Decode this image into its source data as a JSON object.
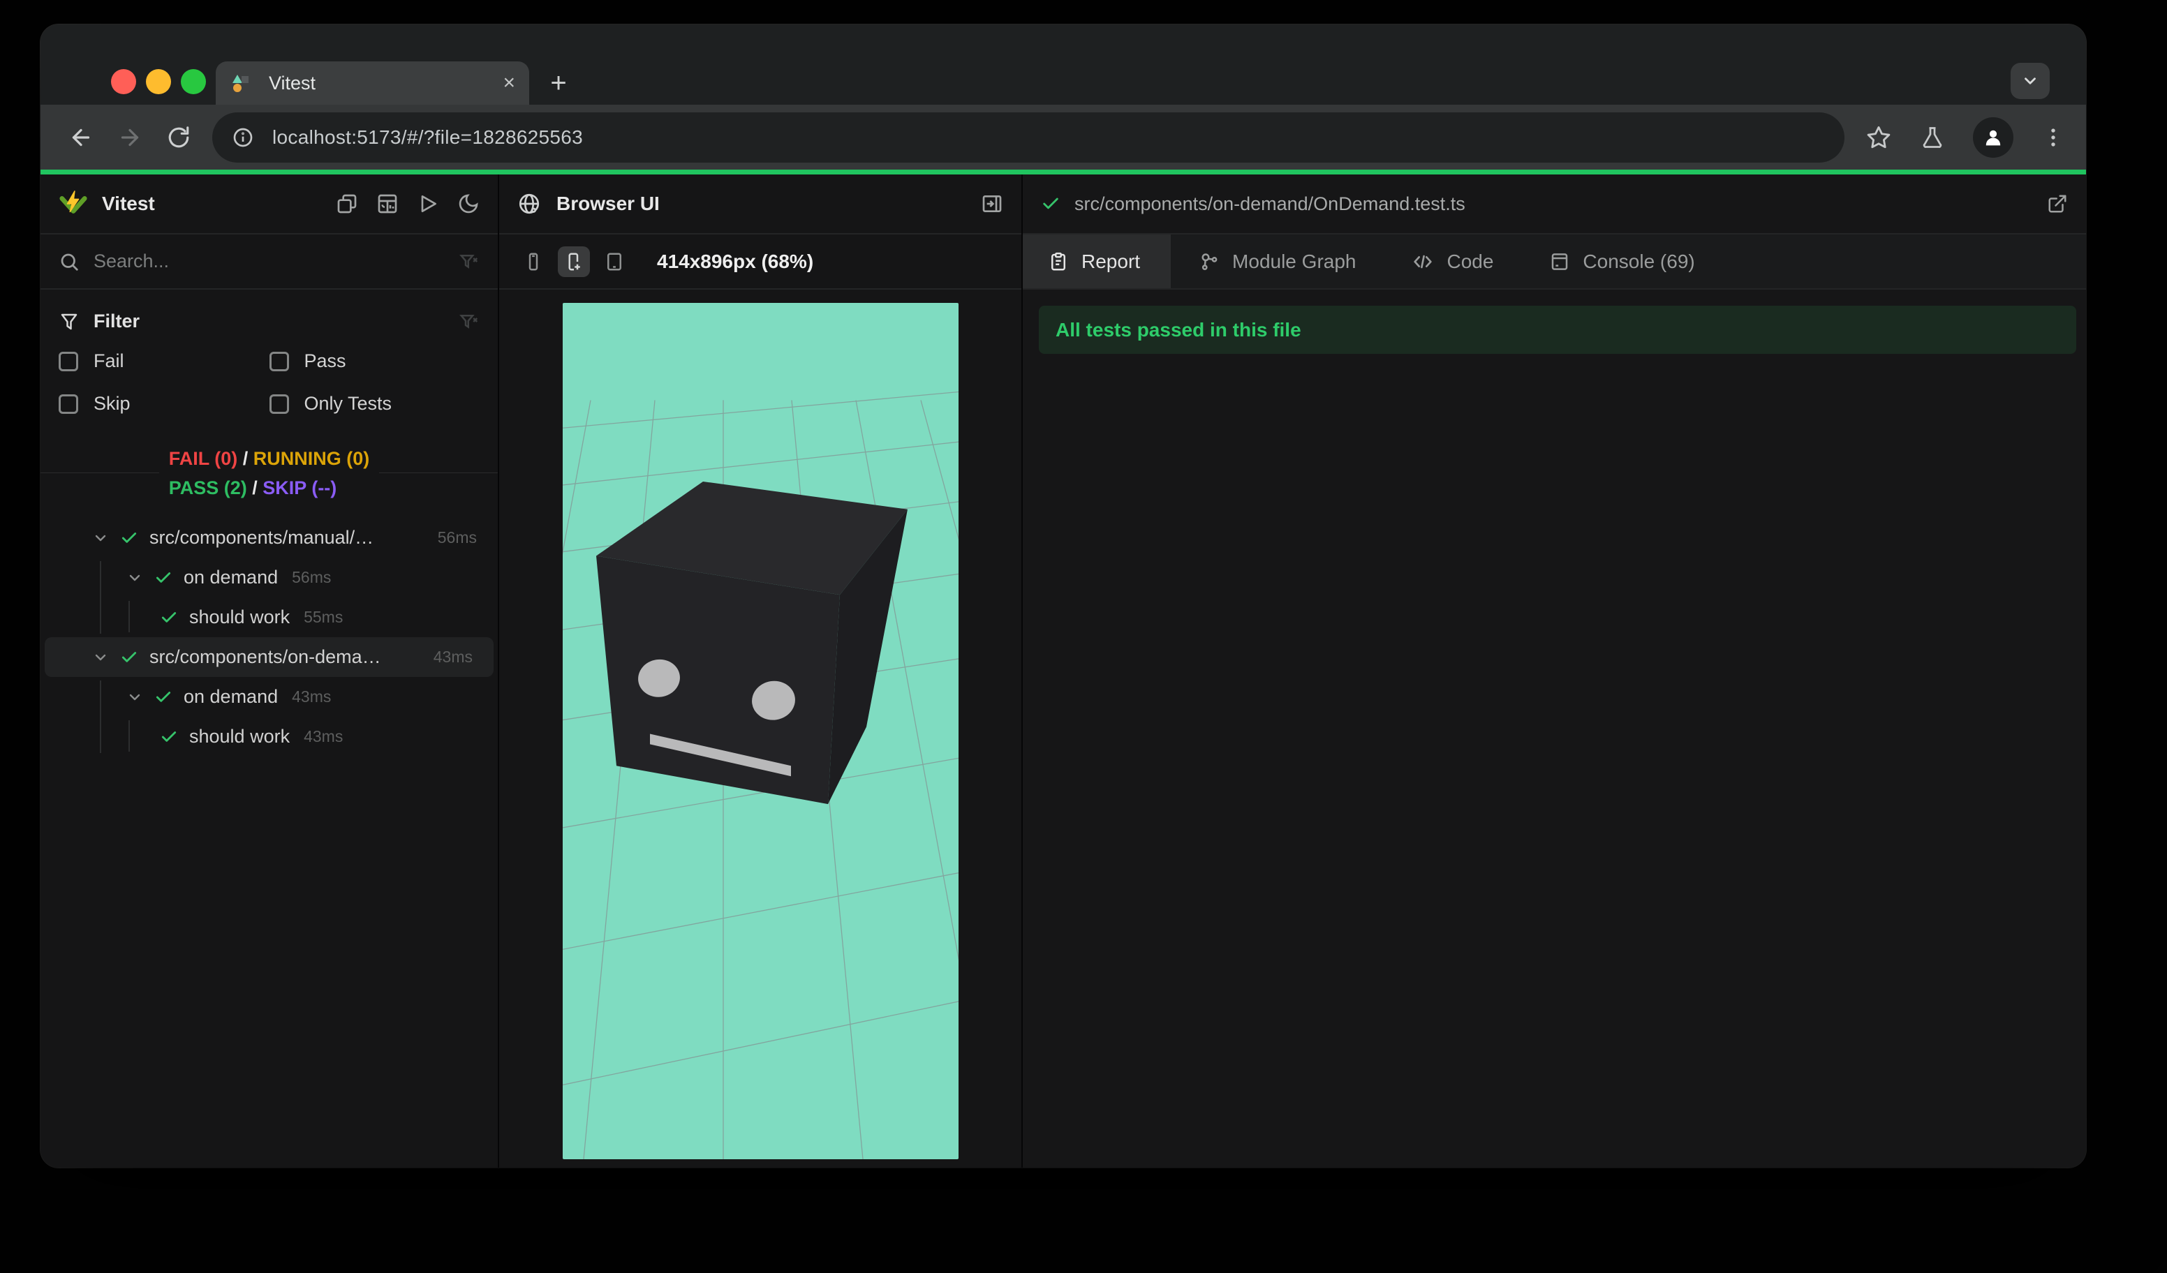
{
  "browser": {
    "tab_title": "Vitest",
    "close_glyph": "×",
    "new_tab_glyph": "+",
    "url": "localhost:5173/#/?file=1828625563"
  },
  "sidebar": {
    "title": "Vitest",
    "search_placeholder": "Search...",
    "filter": {
      "title": "Filter",
      "options": [
        "Fail",
        "Pass",
        "Skip",
        "Only Tests"
      ]
    },
    "summary": {
      "fail": "FAIL (0)",
      "running": "RUNNING (0)",
      "pass": "PASS (2)",
      "skip": "SKIP (--)",
      "separator": "/"
    },
    "tree": [
      {
        "label": "src/components/manual/…",
        "duration": "56ms"
      },
      {
        "label": "on demand",
        "duration": "56ms"
      },
      {
        "label": "should work",
        "duration": "55ms"
      },
      {
        "label": "src/components/on-dema…",
        "duration": "43ms"
      },
      {
        "label": "on demand",
        "duration": "43ms"
      },
      {
        "label": "should work",
        "duration": "43ms"
      }
    ]
  },
  "browser_ui": {
    "title": "Browser UI",
    "dimensions": "414x896px (68%)"
  },
  "report": {
    "file_path": "src/components/on-demand/OnDemand.test.ts",
    "tabs": [
      "Report",
      "Module Graph",
      "Code",
      "Console (69)"
    ],
    "active_tab": "Report",
    "banner": "All tests passed in this file"
  },
  "colors": {
    "accent_green": "#20c45f",
    "pass_green": "#2ebd62",
    "fail_red": "#ef4444",
    "running_yellow": "#dca408",
    "skip_purple": "#8a5cf5",
    "viewport_teal": "#7fdcc1",
    "banner_bg": "#1a2b20",
    "banner_text": "#2ecc6a"
  }
}
